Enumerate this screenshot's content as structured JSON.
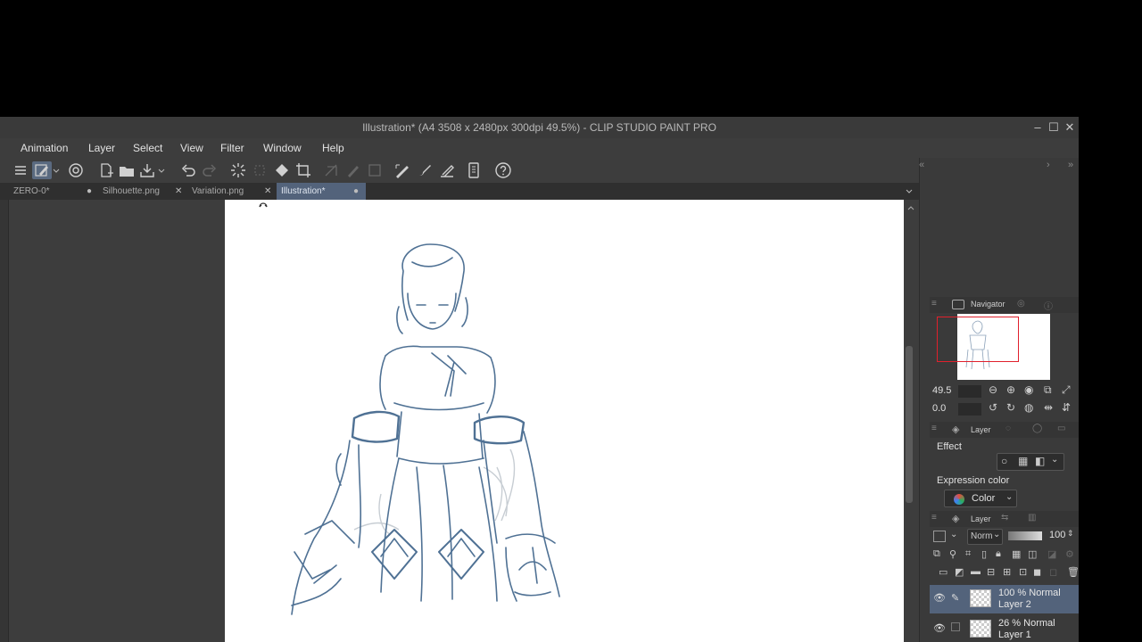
{
  "window": {
    "title": "Illustration* (A4 3508 x 2480px 300dpi 49.5%)  - CLIP STUDIO PAINT PRO",
    "controls": {
      "minimize": "–",
      "maximize": "☐",
      "close": "✕"
    }
  },
  "menu": {
    "items": [
      "Animation",
      "Layer",
      "Select",
      "View",
      "Filter",
      "Window",
      "Help"
    ]
  },
  "tabs": [
    {
      "label": "ZERO-0*",
      "mark": "●"
    },
    {
      "label": "Silhouette.png",
      "mark": "✕"
    },
    {
      "label": "Variation.png",
      "mark": "✕"
    },
    {
      "label": "Illustration*",
      "mark": "●"
    }
  ],
  "navigator": {
    "title": "Navigator",
    "zoom": "49.5",
    "rotation": "0.0"
  },
  "layer_property": {
    "title": "Layer",
    "effect_label": "Effect",
    "expression_label": "Expression color",
    "expression_value": "Color"
  },
  "layers_panel": {
    "title": "Layer",
    "blend_mode": "Norm",
    "opacity": "100",
    "layers": [
      {
        "opacity_mode": "100 % Normal",
        "name": "Layer 2",
        "selected": true
      },
      {
        "opacity_mode": "26 % Normal",
        "name": "Layer 1",
        "selected": false
      }
    ]
  },
  "colors": {
    "accent": "#53637b",
    "sketch_stroke": "#4f7194",
    "navigator_frame": "#e0202c"
  }
}
